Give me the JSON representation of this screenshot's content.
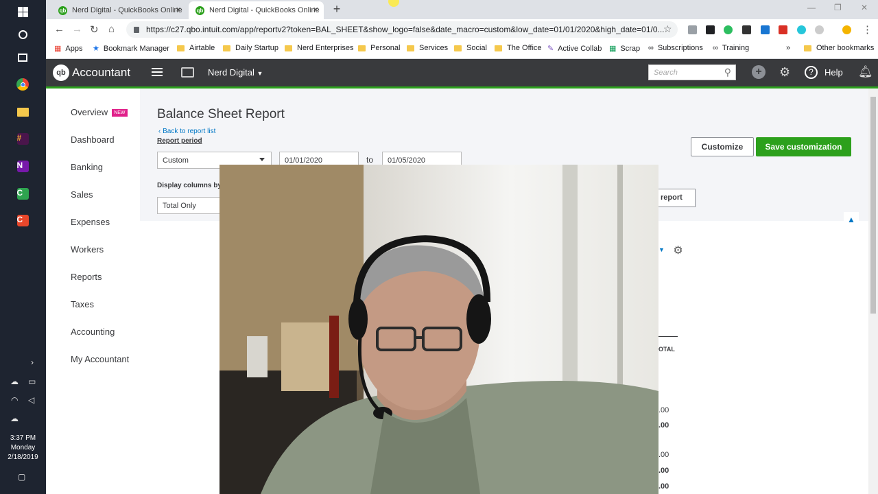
{
  "taskbar": {
    "clock": {
      "time": "3:37 PM",
      "day": "Monday",
      "date": "2/18/2019"
    }
  },
  "browser": {
    "tabs": [
      {
        "title": "Nerd Digital - QuickBooks Online",
        "active": false
      },
      {
        "title": "Nerd Digital - QuickBooks Online",
        "active": true
      }
    ],
    "url": "https://c27.qbo.intuit.com/app/reportv2?token=BAL_SHEET&show_logo=false&date_macro=custom&low_date=01/01/2020&high_date=01/0...",
    "bookmarks": {
      "apps": "Apps",
      "manager": "Bookmark Manager",
      "airtable": "Airtable",
      "daily": "Daily Startup",
      "nerd": "Nerd Enterprises",
      "personal": "Personal",
      "services": "Services",
      "social": "Social",
      "office": "The Office",
      "collab": "Active Collab",
      "scrap": "Scrap",
      "subs": "Subscriptions",
      "training": "Training",
      "more": "»",
      "other": "Other bookmarks"
    }
  },
  "qb": {
    "brand": "Accountant",
    "logo": "qb",
    "company": "Nerd Digital",
    "search_placeholder": "Search",
    "help": "Help",
    "green": "#2ca01c",
    "dark": "#393a3d"
  },
  "nav": {
    "overview": "Overview",
    "overview_badge": "NEW",
    "dashboard": "Dashboard",
    "banking": "Banking",
    "sales": "Sales",
    "expenses": "Expenses",
    "workers": "Workers",
    "reports": "Reports",
    "taxes": "Taxes",
    "accounting": "Accounting",
    "my_accountant": "My Accountant"
  },
  "report": {
    "title": "Balance Sheet Report",
    "back_link": "Back to report list",
    "period_label": "Report period",
    "period_value": "Custom",
    "from_date": "01/01/2020",
    "to_label": "to",
    "to_date": "01/05/2020",
    "display_label": "Display columns by",
    "display_value": "Total Only",
    "customize": "Customize",
    "save_customization": "Save customization",
    "run_report": "report",
    "total_header": "OTAL",
    "amounts": [
      ".00",
      ".00",
      ".00",
      ".00",
      ".00"
    ]
  }
}
